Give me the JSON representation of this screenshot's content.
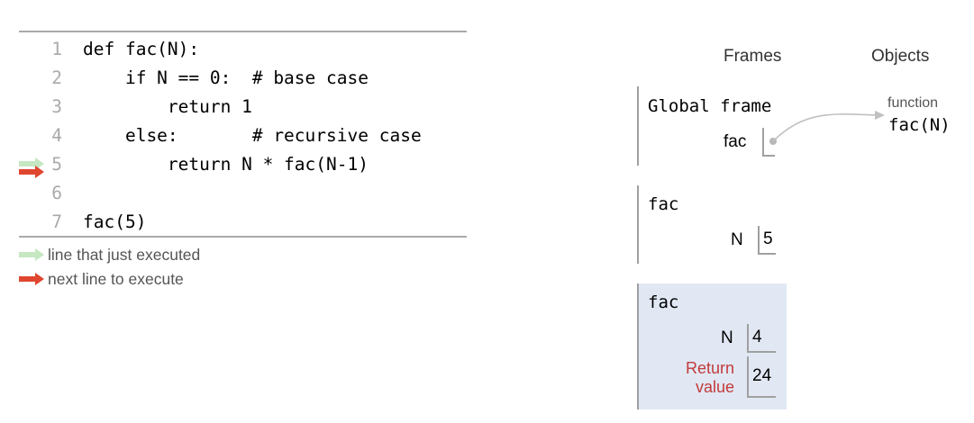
{
  "code": {
    "lines": [
      {
        "number": "1",
        "text": "def fac(N):"
      },
      {
        "number": "2",
        "text": "    if N == 0:  # base case"
      },
      {
        "number": "3",
        "text": "        return 1"
      },
      {
        "number": "4",
        "text": "    else:       # recursive case"
      },
      {
        "number": "5",
        "text": "        return N * fac(N-1)"
      },
      {
        "number": "6",
        "text": ""
      },
      {
        "number": "7",
        "text": "fac(5)"
      }
    ],
    "just_executed_line": 5,
    "next_line": 5
  },
  "legend": {
    "just_executed": "line that just executed",
    "next_to_execute": "next line to execute"
  },
  "colors": {
    "just_executed_arrow": "#c5e7c1",
    "next_line_arrow": "#e0462f",
    "active_frame_bg": "#e1e8f4",
    "return_label": "#c23b3b"
  },
  "headers": {
    "frames": "Frames",
    "objects": "Objects"
  },
  "frames": {
    "global": {
      "title": "Global frame",
      "var_name": "fac"
    },
    "fac_1": {
      "title": "fac",
      "var_name": "N",
      "var_value": "5"
    },
    "fac_2": {
      "title": "fac",
      "var_name": "N",
      "var_value": "4",
      "return_label": "Return value",
      "return_value": "24"
    }
  },
  "objects": {
    "function": {
      "type": "function",
      "value": "fac(N)"
    }
  }
}
